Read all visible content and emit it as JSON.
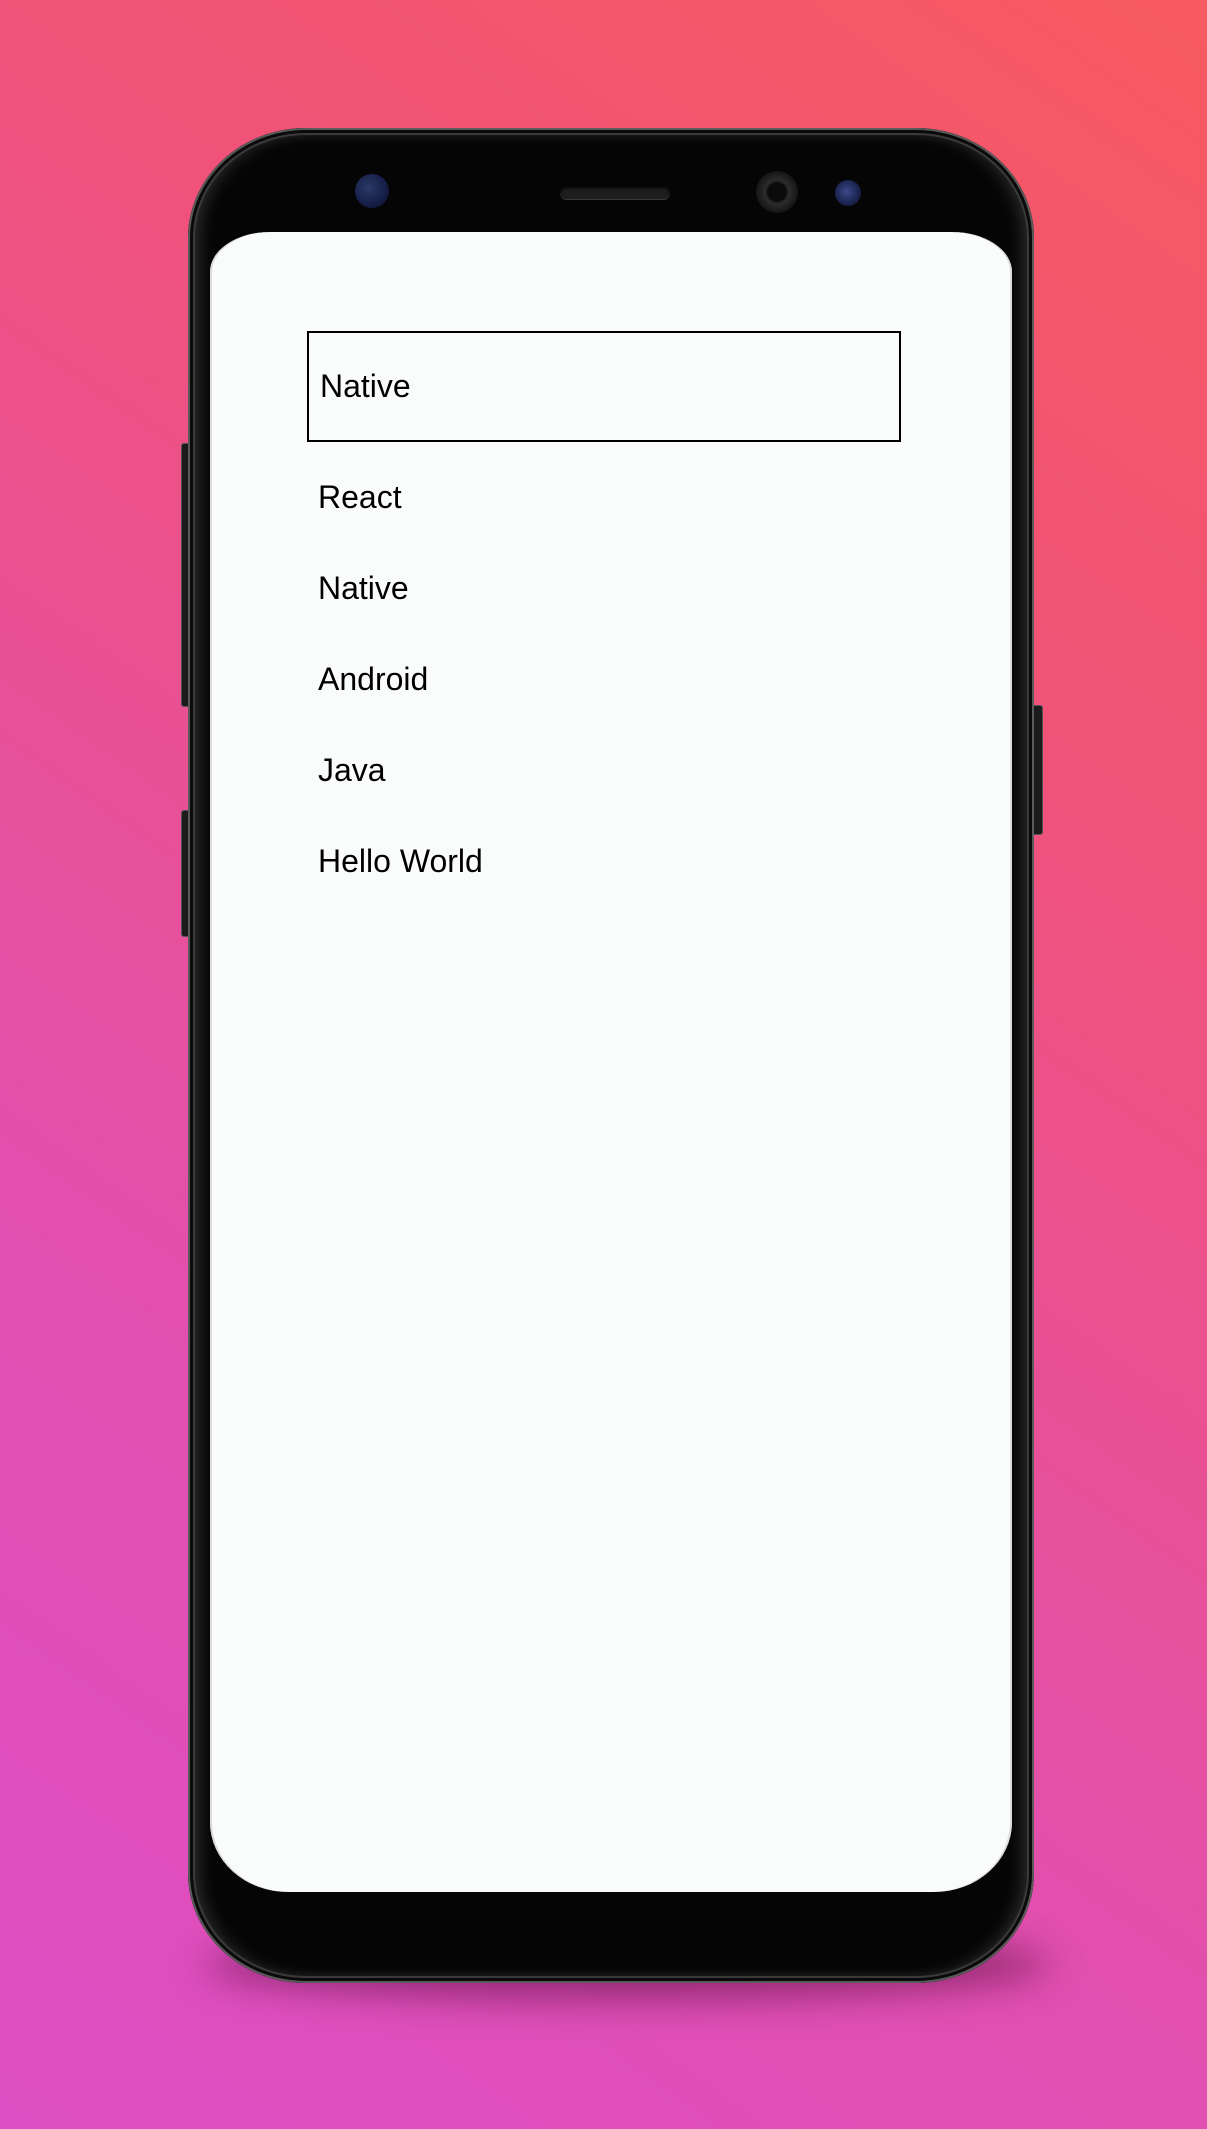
{
  "selected": {
    "value": "Native"
  },
  "list": {
    "items": [
      {
        "label": "React"
      },
      {
        "label": "Native"
      },
      {
        "label": "Android"
      },
      {
        "label": "Java"
      },
      {
        "label": "Hello World"
      }
    ]
  },
  "colors": {
    "background_gradient_start": "#f75a5f",
    "background_gradient_end": "#dd4ec4",
    "screen_background": "#fafbfb",
    "text": "#000000"
  }
}
